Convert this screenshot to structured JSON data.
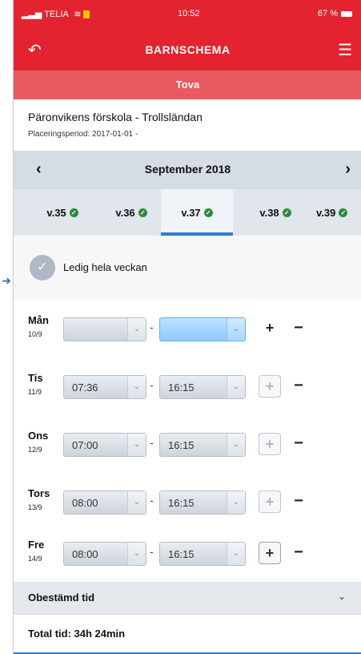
{
  "status_bar": {
    "carrier": "TELIA",
    "time": "10:52",
    "battery": "67 %"
  },
  "nav": {
    "title": "BARNSCHEMA",
    "back_icon": "back-arrow-icon",
    "menu_icon": "hamburger-menu-icon"
  },
  "child": {
    "name": "Tova"
  },
  "placement": {
    "school": "Päronvikens förskola - Trollsländan",
    "period": "Placeringsperiod: 2017-01-01 -"
  },
  "month": {
    "label": "September 2018",
    "prev": "‹",
    "next": "›"
  },
  "weeks": [
    {
      "label": "v.35"
    },
    {
      "label": "v.36"
    },
    {
      "label": "v.37"
    },
    {
      "label": "v.38"
    },
    {
      "label": "v.39"
    }
  ],
  "active_week": "v.37",
  "free_week": {
    "label": "Ledig hela veckan"
  },
  "days": [
    {
      "name": "Mån",
      "date": "10/9",
      "start": "",
      "end": ""
    },
    {
      "name": "Tis",
      "date": "11/9",
      "start": "07:36",
      "end": "16:15"
    },
    {
      "name": "Ons",
      "date": "12/9",
      "start": "07:00",
      "end": "16:15"
    },
    {
      "name": "Tors",
      "date": "13/9",
      "start": "08:00",
      "end": "16:15"
    },
    {
      "name": "Fre",
      "date": "14/9",
      "start": "08:00",
      "end": "16:15"
    }
  ],
  "undecided": {
    "label": "Obestämd tid"
  },
  "total": {
    "label": "Total tid: 34h 24min"
  },
  "colors": {
    "brand_red": "#e3232f",
    "accent_blue": "#2a7dd6",
    "check_green": "#2e8b3d"
  }
}
